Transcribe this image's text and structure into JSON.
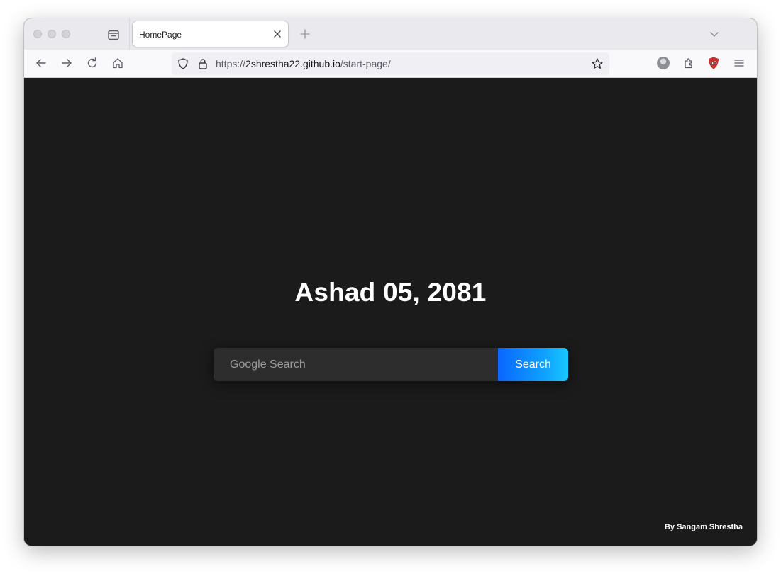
{
  "browser": {
    "tab": {
      "title": "HomePage"
    },
    "url": {
      "prefix": "https://",
      "host": "2shrestha22.github.io",
      "path": "/start-page/"
    }
  },
  "page": {
    "date_heading": "Ashad 05, 2081",
    "search": {
      "placeholder": "Google Search",
      "button_label": "Search"
    },
    "credit": "By Sangam Shrestha"
  },
  "colors": {
    "page_background": "#1b1b1b",
    "search_input_background": "#2d2d2d",
    "search_button_gradient_start": "#0a66ff",
    "search_button_gradient_end": "#19c8ff",
    "ublock_red": "#c4302b"
  },
  "icons": {
    "tabs": "tab-manager-icon",
    "tab_close": "close-icon",
    "new_tab": "plus-icon",
    "tab_list": "chevron-down-icon",
    "back": "arrow-left-icon",
    "forward": "arrow-right-icon",
    "reload": "reload-icon",
    "home": "home-icon",
    "tracking_protection": "shield-icon",
    "secure": "lock-icon",
    "bookmark": "star-icon",
    "account": "avatar",
    "extensions": "puzzle-icon",
    "ublock": "ublock-shield-icon",
    "menu": "hamburger-menu-icon"
  }
}
